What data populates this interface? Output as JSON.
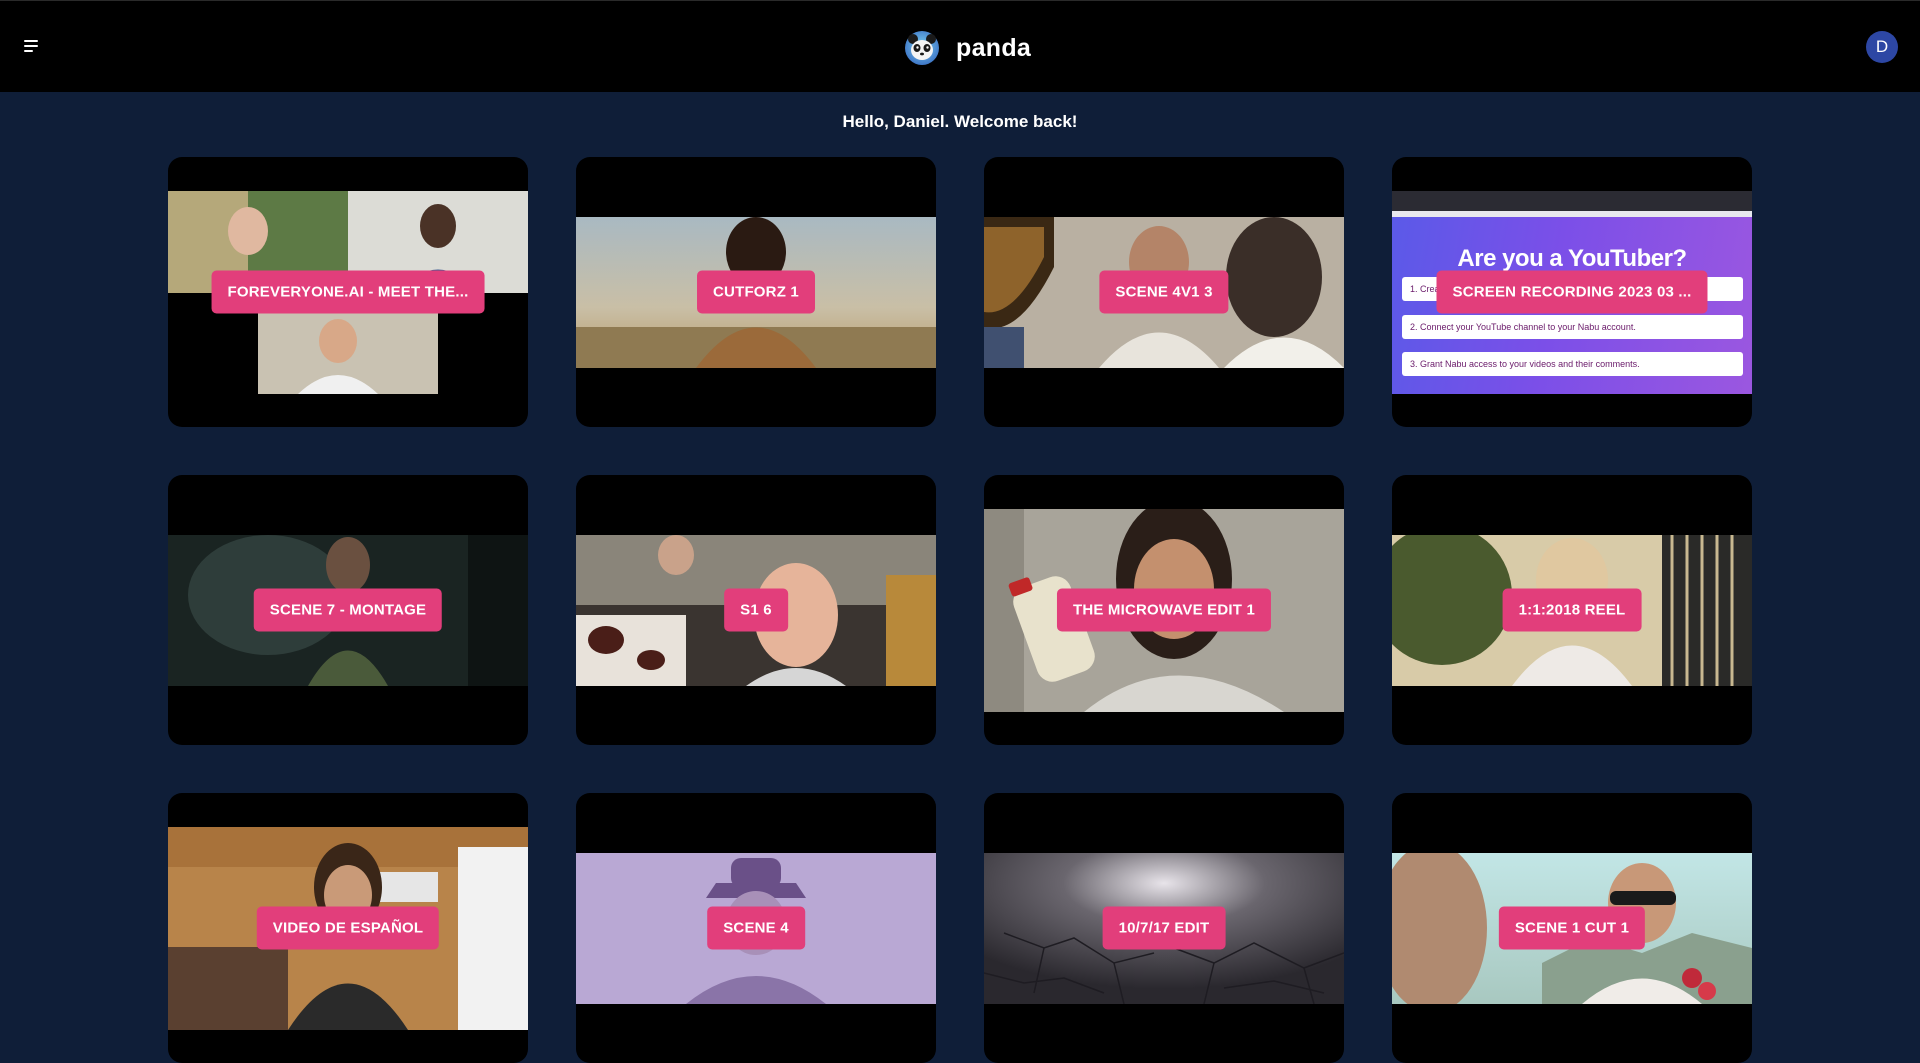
{
  "app": {
    "name": "panda"
  },
  "header": {
    "menu_icon": "hamburger-menu-icon",
    "logo_icon": "panda-logo-icon",
    "avatar_initial": "D"
  },
  "greeting": "Hello, Daniel. Welcome back!",
  "colors": {
    "background": "#0f1e38",
    "topbar": "#000000",
    "label": "#e23e7b",
    "avatar": "#2d47a4"
  },
  "videos": [
    {
      "title": "FOREVERYONE.AI - MEET THE..."
    },
    {
      "title": "CUTFORZ 1"
    },
    {
      "title": "SCENE 4V1 3"
    },
    {
      "title": "SCREEN RECORDING 2023 03 ...",
      "thumbnail_text": {
        "heading": "Are you a YouTuber?",
        "steps": [
          "1.  Create a",
          "2.  Connect your YouTube channel to your Nabu account.",
          "3.  Grant Nabu access to your videos and their comments."
        ]
      }
    },
    {
      "title": "SCENE 7 - MONTAGE"
    },
    {
      "title": "S1 6"
    },
    {
      "title": "THE MICROWAVE EDIT 1"
    },
    {
      "title": "1:1:2018 REEL"
    },
    {
      "title": "VIDEO DE ESPAÑOL"
    },
    {
      "title": "SCENE 4"
    },
    {
      "title": "10/7/17 EDIT"
    },
    {
      "title": "SCENE 1 CUT 1"
    }
  ]
}
